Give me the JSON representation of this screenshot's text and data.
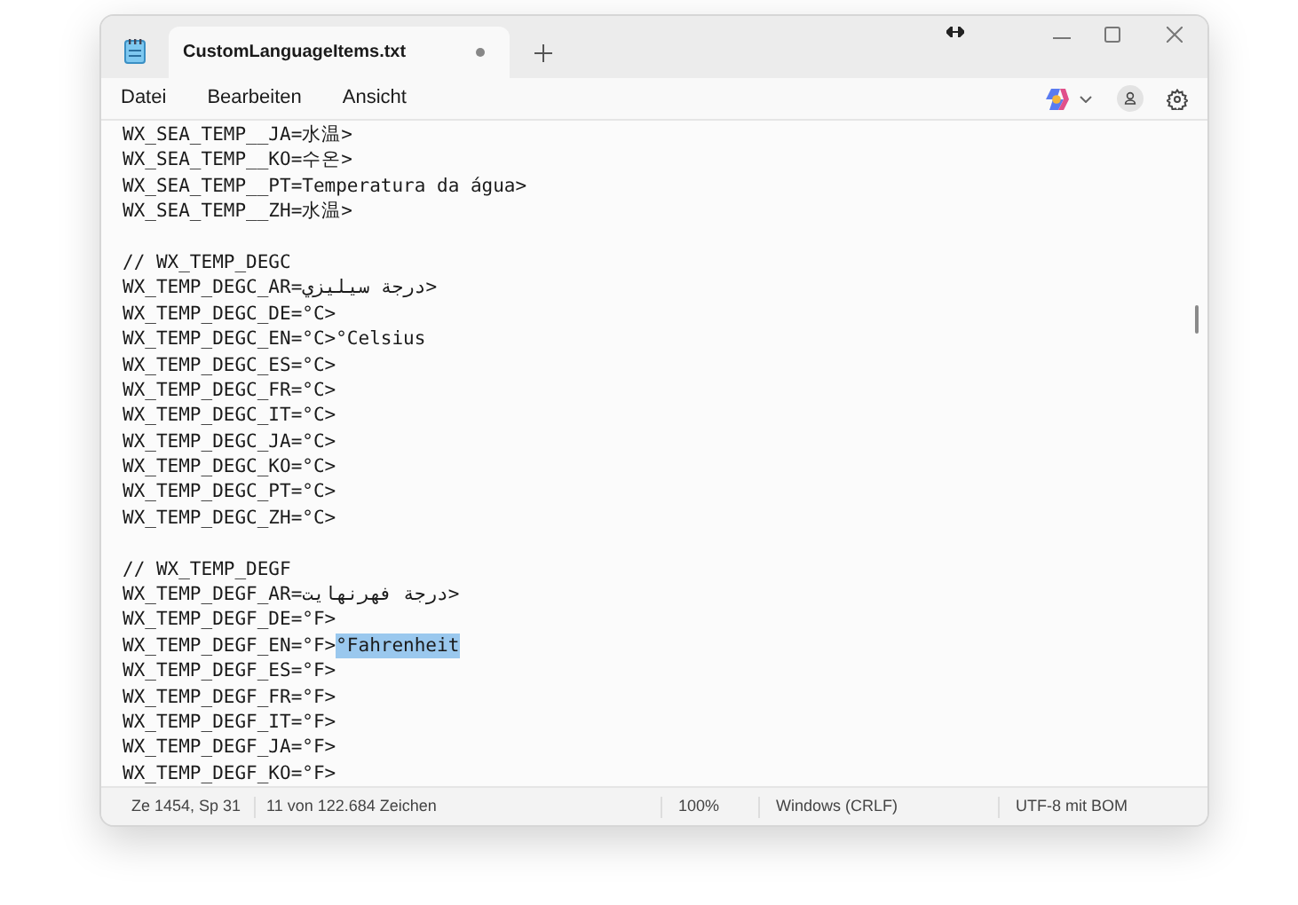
{
  "tab": {
    "title": "CustomLanguageItems.txt",
    "modified": true
  },
  "menu": [
    "Datei",
    "Bearbeiten",
    "Ansicht"
  ],
  "lines": [
    {
      "kind": "text",
      "text": "WX_SEA_TEMP__JA=水温>"
    },
    {
      "kind": "text",
      "text": "WX_SEA_TEMP__KO=수온>"
    },
    {
      "kind": "text",
      "text": "WX_SEA_TEMP__PT=Temperatura da água>"
    },
    {
      "kind": "text",
      "text": "WX_SEA_TEMP__ZH=水温>"
    },
    {
      "kind": "blank"
    },
    {
      "kind": "text",
      "text": "// WX_TEMP_DEGC"
    },
    {
      "kind": "text",
      "text": "WX_TEMP_DEGC_AR=درجة سيليزي>"
    },
    {
      "kind": "text",
      "text": "WX_TEMP_DEGC_DE=°C>"
    },
    {
      "kind": "text",
      "text": "WX_TEMP_DEGC_EN=°C>°Celsius"
    },
    {
      "kind": "text",
      "text": "WX_TEMP_DEGC_ES=°C>"
    },
    {
      "kind": "text",
      "text": "WX_TEMP_DEGC_FR=°C>"
    },
    {
      "kind": "text",
      "text": "WX_TEMP_DEGC_IT=°C>"
    },
    {
      "kind": "text",
      "text": "WX_TEMP_DEGC_JA=°C>"
    },
    {
      "kind": "text",
      "text": "WX_TEMP_DEGC_KO=°C>"
    },
    {
      "kind": "text",
      "text": "WX_TEMP_DEGC_PT=°C>"
    },
    {
      "kind": "text",
      "text": "WX_TEMP_DEGC_ZH=°C>"
    },
    {
      "kind": "blank"
    },
    {
      "kind": "text",
      "text": "// WX_TEMP_DEGF"
    },
    {
      "kind": "text",
      "text": "WX_TEMP_DEGF_AR=درجة فهرنهايت>"
    },
    {
      "kind": "text",
      "text": "WX_TEMP_DEGF_DE=°F>"
    },
    {
      "kind": "text",
      "text": "WX_TEMP_DEGF_EN=°F>",
      "selected_text": "°Fahrenheit"
    },
    {
      "kind": "text",
      "text": "WX_TEMP_DEGF_ES=°F>"
    },
    {
      "kind": "text",
      "text": "WX_TEMP_DEGF_FR=°F>"
    },
    {
      "kind": "text",
      "text": "WX_TEMP_DEGF_IT=°F>"
    },
    {
      "kind": "text",
      "text": "WX_TEMP_DEGF_JA=°F>"
    },
    {
      "kind": "text",
      "text": "WX_TEMP_DEGF_KO=°F>"
    }
  ],
  "status_bar": {
    "position": "Ze 1454, Sp 31",
    "selection": "11 von 122.684 Zeichen",
    "zoom": "100%",
    "line_endings": "Windows (CRLF)",
    "encoding": "UTF-8 mit BOM"
  }
}
